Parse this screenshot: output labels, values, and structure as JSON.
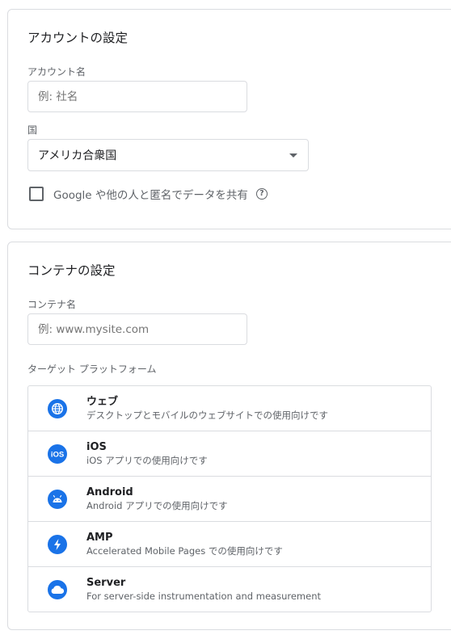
{
  "account": {
    "title": "アカウントの設定",
    "name_label": "アカウント名",
    "name_placeholder": "例: 社名",
    "country_label": "国",
    "country_value": "アメリカ合衆国",
    "share_label": "Google や他の人と匿名でデータを共有",
    "help_glyph": "?"
  },
  "container": {
    "title": "コンテナの設定",
    "name_label": "コンテナ名",
    "name_placeholder": "例: www.mysite.com",
    "platform_label": "ターゲット プラットフォーム",
    "platforms": [
      {
        "icon": "globe-icon",
        "name": "ウェブ",
        "desc": "デスクトップとモバイルのウェブサイトでの使用向けです"
      },
      {
        "icon": "ios-icon",
        "name": "iOS",
        "desc": "iOS アプリでの使用向けです"
      },
      {
        "icon": "android-icon",
        "name": "Android",
        "desc": "Android アプリでの使用向けです"
      },
      {
        "icon": "amp-icon",
        "name": "AMP",
        "desc": "Accelerated Mobile Pages での使用向けです"
      },
      {
        "icon": "cloud-icon",
        "name": "Server",
        "desc": "For server-side instrumentation and measurement"
      }
    ]
  },
  "colors": {
    "accent": "#1a73e8",
    "border": "#dadce0",
    "secondary_text": "#5f6368"
  }
}
